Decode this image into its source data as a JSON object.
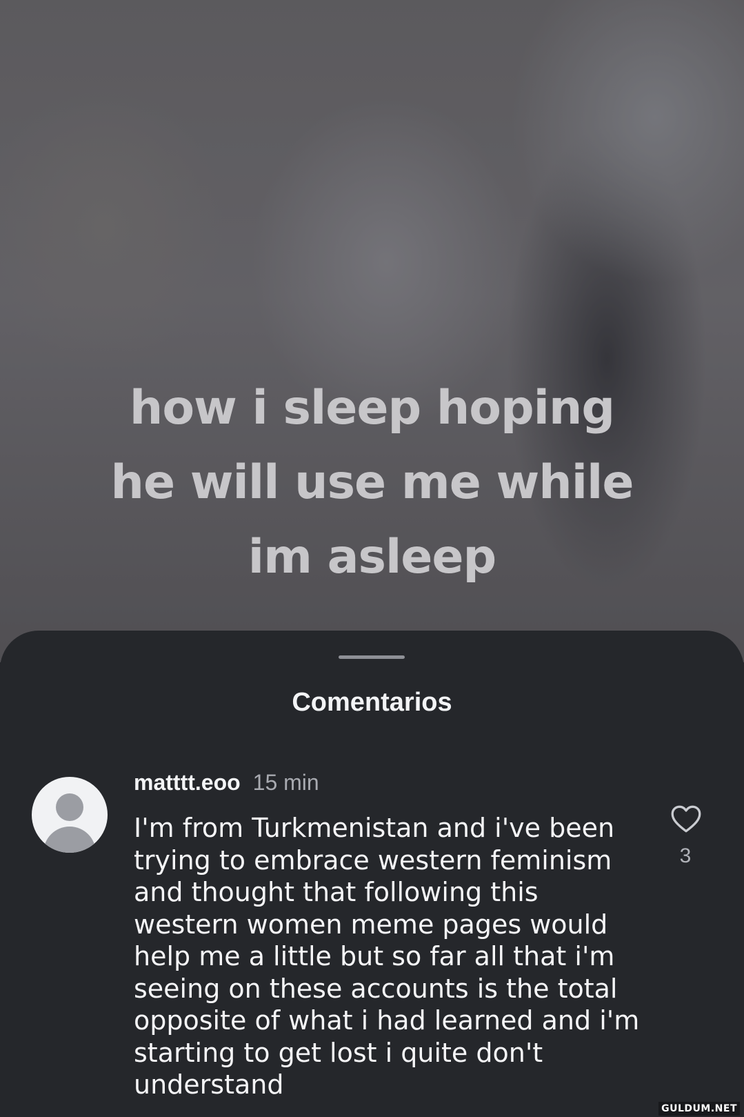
{
  "media": {
    "caption_lines": [
      "how i sleep  hoping",
      "he will use me while",
      "im asleep"
    ]
  },
  "sheet": {
    "title": "Comentarios"
  },
  "comment": {
    "username": "matttt.eoo",
    "time": "15 min",
    "text": "I'm from Turkmenistan and i've been trying to embrace western feminism and thought that following this western women meme pages would help me a little but so far all that i'm seeing on these accounts is the total opposite of what i had learned and i'm starting to get lost i quite don't understand",
    "likes": "3",
    "like_icon": "heart-icon",
    "avatar_icon": "default-avatar-icon"
  },
  "watermark": "GULDUM.NET"
}
